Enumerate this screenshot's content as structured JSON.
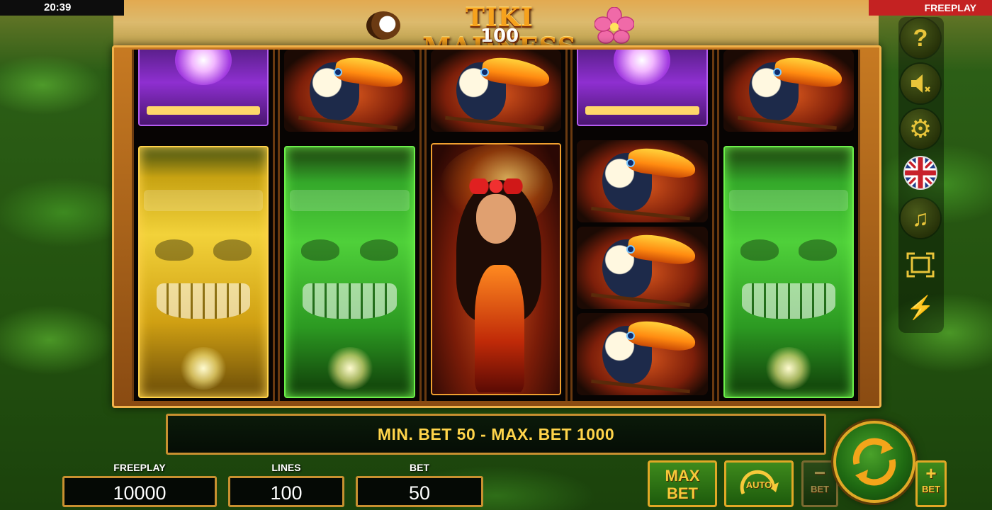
{
  "status_bar": {
    "time": "20:39",
    "mode": "FREEPLAY"
  },
  "logo": {
    "title": "TIKI MADNESS",
    "subtitle": "100"
  },
  "reels": [
    [
      "purple-idol",
      "gold-tiki"
    ],
    [
      "toucan",
      "green-tiki"
    ],
    [
      "toucan",
      "fire-dancer"
    ],
    [
      "purple-idol",
      "toucan",
      "toucan",
      "toucan"
    ],
    [
      "toucan",
      "green-tiki"
    ]
  ],
  "message": "MIN. BET 50 - MAX. BET 1000",
  "stats": {
    "balance": {
      "label": "FREEPLAY",
      "value": "10000"
    },
    "lines": {
      "label": "LINES",
      "value": "100"
    },
    "bet": {
      "label": "BET",
      "value": "50"
    }
  },
  "side_menu": [
    {
      "icon": "help-icon",
      "glyph": "?"
    },
    {
      "icon": "sound-muted-icon",
      "glyph": ""
    },
    {
      "icon": "settings-gear-icon",
      "glyph": "⚙"
    },
    {
      "icon": "language-uk-flag-icon",
      "glyph": ""
    },
    {
      "icon": "music-note-icon",
      "glyph": "♫"
    },
    {
      "icon": "fullscreen-icon",
      "glyph": ""
    },
    {
      "icon": "turbo-lightning-icon",
      "glyph": "⚡"
    }
  ],
  "controls": {
    "max_bet_line1": "MAX",
    "max_bet_line2": "BET",
    "auto_label": "AUTO",
    "bet_minus_symbol": "−",
    "bet_minus_label": "BET",
    "bet_plus_symbol": "+",
    "bet_plus_label": "BET"
  },
  "colors": {
    "accent_gold": "#ffd44a",
    "frame_gold": "#c89030",
    "freeplay_red": "#c42222"
  }
}
